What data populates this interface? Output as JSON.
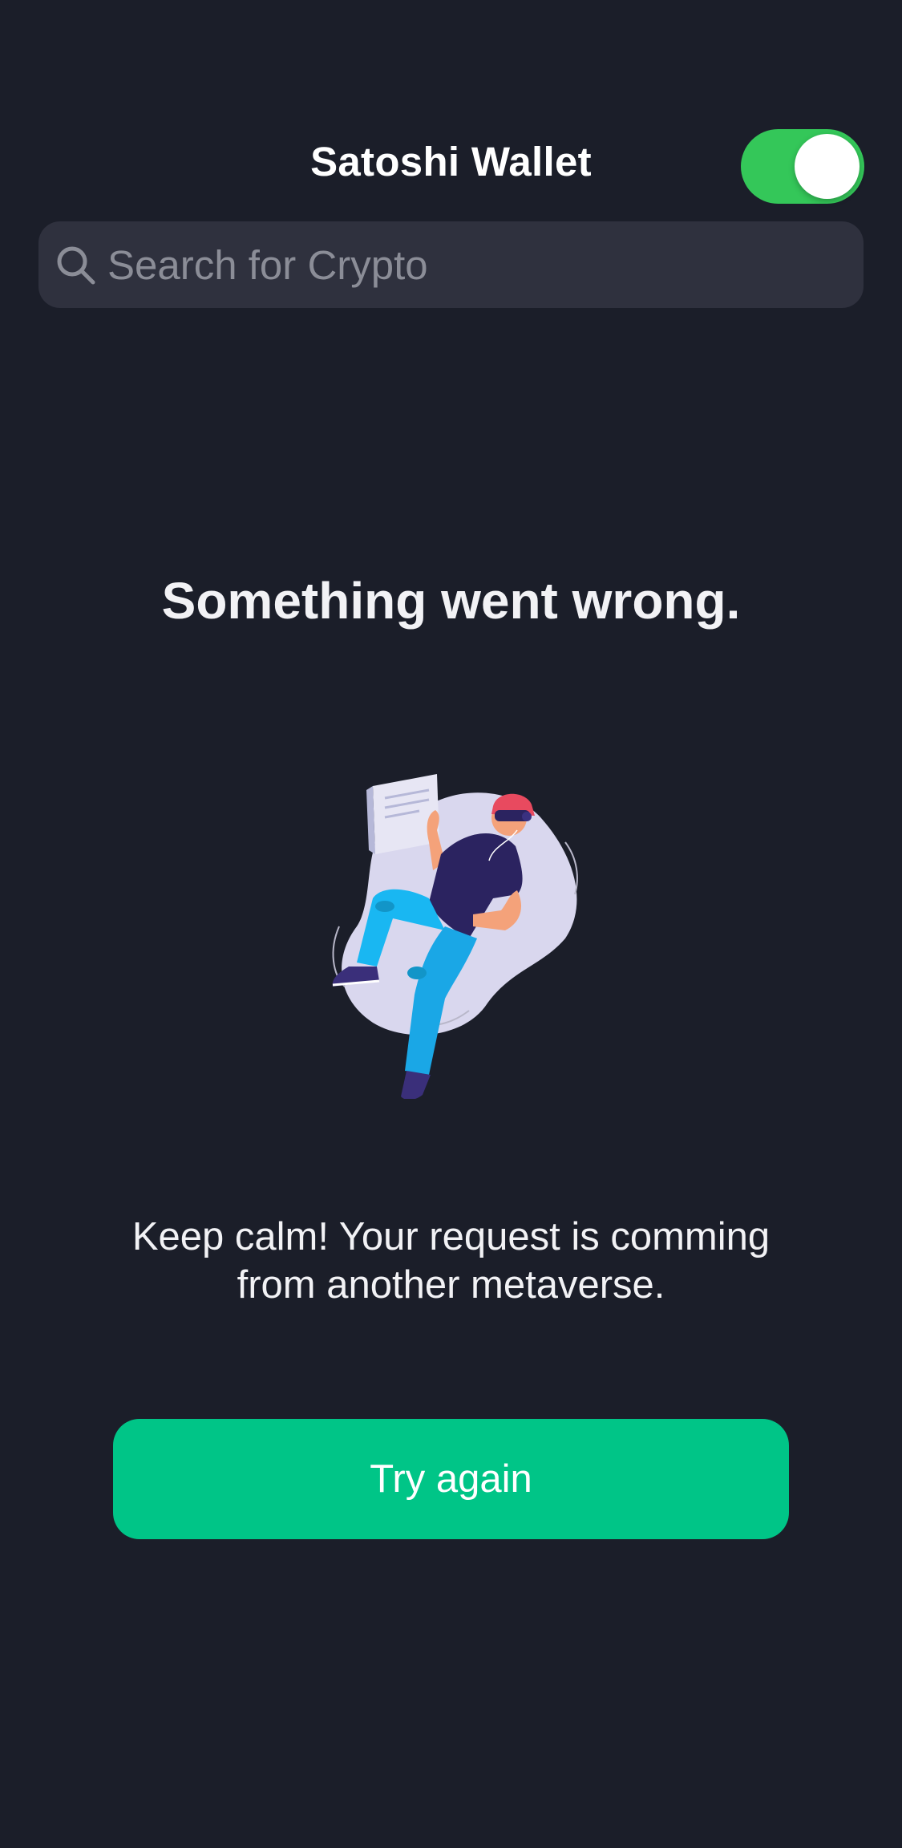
{
  "header": {
    "title": "Satoshi Wallet",
    "toggle_on": true,
    "toggle_color": "#34c759"
  },
  "search": {
    "placeholder": "Search for Crypto",
    "value": "",
    "icon": "search-icon"
  },
  "error": {
    "title": "Something went wrong.",
    "illustration": "person-floating-with-vr-headset-illustration",
    "message_line1": "Keep calm! Your request is comming",
    "message_line2": "from another metaverse."
  },
  "actions": {
    "try_again_label": "Try again",
    "button_color": "#00c587"
  },
  "theme": {
    "background": "#1b1e29",
    "search_background": "#2f313e"
  }
}
